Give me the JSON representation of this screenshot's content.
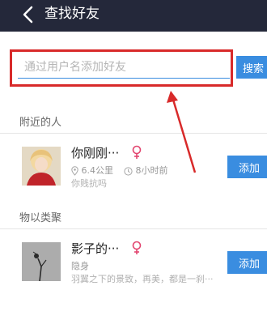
{
  "header": {
    "title": "查找好友",
    "back_icon": "chevron-left-icon"
  },
  "search": {
    "placeholder": "通过用户名添加好友",
    "value": "",
    "button_label": "搜索"
  },
  "colors": {
    "header_bg": "#24283a",
    "accent": "#3a8de0",
    "highlight": "#d82a2a",
    "female": "#e2456f"
  },
  "sections": [
    {
      "title": "附近的人"
    },
    {
      "title": "物以类聚"
    }
  ],
  "users": [
    {
      "name": "你刚刚···",
      "gender_icon": "female-icon",
      "distance": "6.4公里",
      "time": "8小时前",
      "status": "你贱抗吗",
      "add_label": "添加"
    },
    {
      "name": "影子的···",
      "gender_icon": "female-icon",
      "distance": "",
      "time": "隐身",
      "status": "羽翼之下的景致，再美，都是一刹···",
      "add_label": "添加"
    }
  ]
}
